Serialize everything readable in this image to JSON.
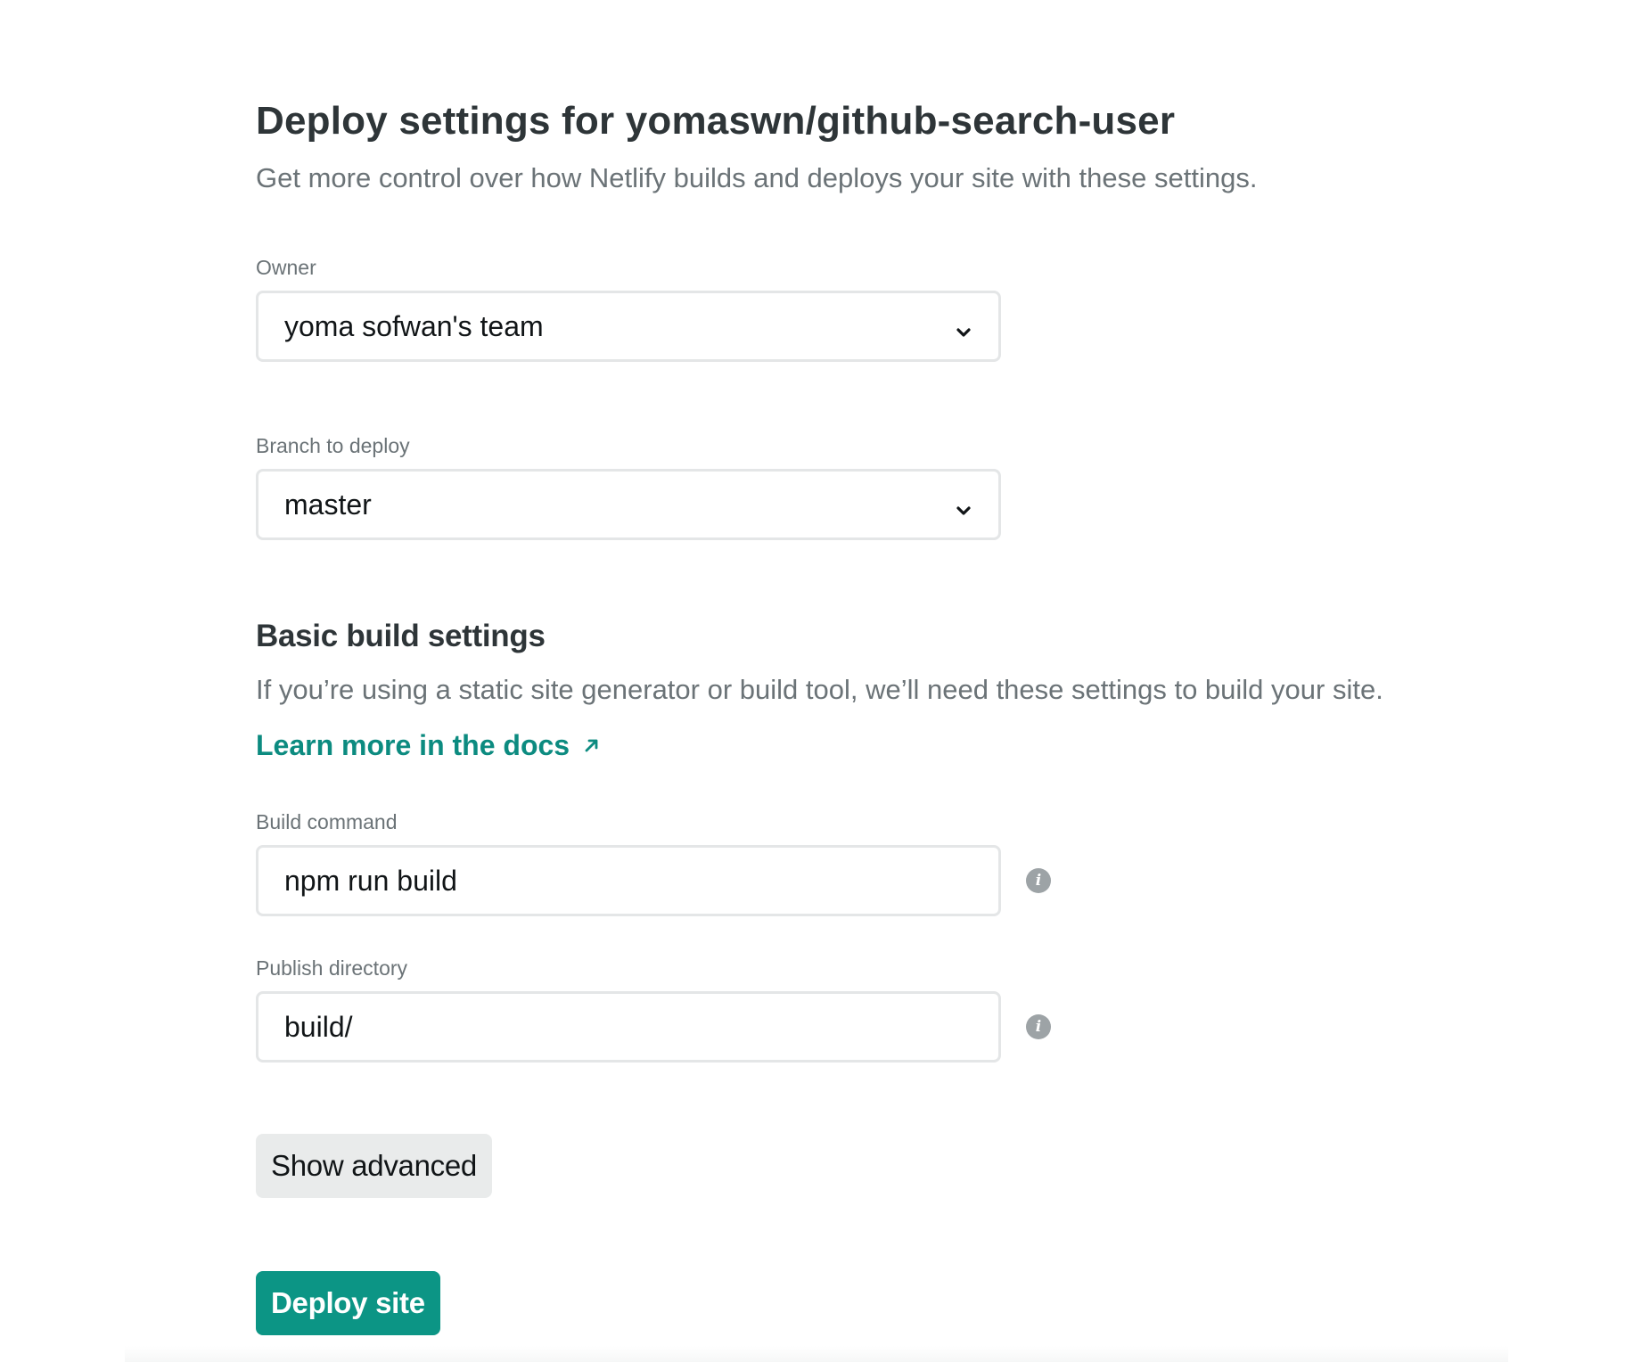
{
  "header": {
    "title": "Deploy settings for yomaswn/github-search-user",
    "subtitle": "Get more control over how Netlify builds and deploys your site with these settings."
  },
  "owner": {
    "label": "Owner",
    "selected": "yoma sofwan's team"
  },
  "branch": {
    "label": "Branch to deploy",
    "selected": "master"
  },
  "build_settings": {
    "title": "Basic build settings",
    "description": "If you’re using a static site generator or build tool, we’ll need these settings to build your site.",
    "docs_link": "Learn more in the docs",
    "build_command": {
      "label": "Build command",
      "value": "npm run build"
    },
    "publish_directory": {
      "label": "Publish directory",
      "value": "build/"
    }
  },
  "actions": {
    "show_advanced": "Show advanced",
    "deploy": "Deploy site"
  },
  "colors": {
    "accent": "#0c9585",
    "link": "#0c8b80",
    "text_primary": "#2e3538",
    "text_muted": "#6b7377",
    "border": "#e4e6e7"
  },
  "icons": {
    "select_arrow": "chevron-down-icon",
    "external_link": "arrow-up-right-icon",
    "info": "info-icon"
  }
}
